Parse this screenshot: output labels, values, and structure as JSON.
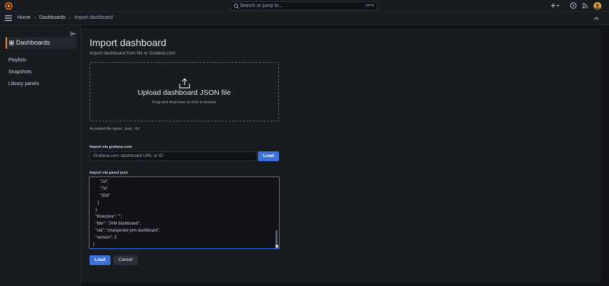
{
  "topbar": {
    "search_placeholder": "Search or jump to...",
    "search_shortcut": "ctrl+k",
    "add_label": "+",
    "icons": [
      "grafana-logo-icon",
      "search-icon",
      "plus-icon",
      "help-icon",
      "news-icon",
      "avatar"
    ]
  },
  "breadcrumb": {
    "items": [
      "Home",
      "Dashboards",
      "Import dashboard"
    ],
    "separator": "›"
  },
  "sidebar": {
    "section_title": "Dashboards",
    "items": [
      "Playlists",
      "Snapshots",
      "Library panels"
    ]
  },
  "main": {
    "title": "Import dashboard",
    "subtitle": "Import dashboard from file or Grafana.com",
    "upload_title": "Upload dashboard JSON file",
    "upload_hint": "Drag and drop here or click to browse",
    "accepted_types": "Accepted file types: .json, .txt",
    "grafana_label": "Import via grafana.com",
    "grafana_placeholder": "Grafana.com dashboard URL or ID",
    "grafana_load": "Load",
    "json_label": "Import via panel json",
    "json_lines": [
      "      \"2d\",",
      "      \"7d\",",
      "      \"30d\"",
      "    ]",
      "  },",
      "  \"timezone\": \"\",",
      "  \"title\": \"JVM dashboard\",",
      "  \"uid\": \"chanjarster-jvm-dashboard\",",
      "  \"version\": 3",
      "}"
    ],
    "load_button": "Load",
    "cancel_button": "Cancel"
  },
  "colors": {
    "accent": "#3d71d9",
    "brand": "#ff8833",
    "background": "#111217",
    "panel": "#181b1f"
  }
}
